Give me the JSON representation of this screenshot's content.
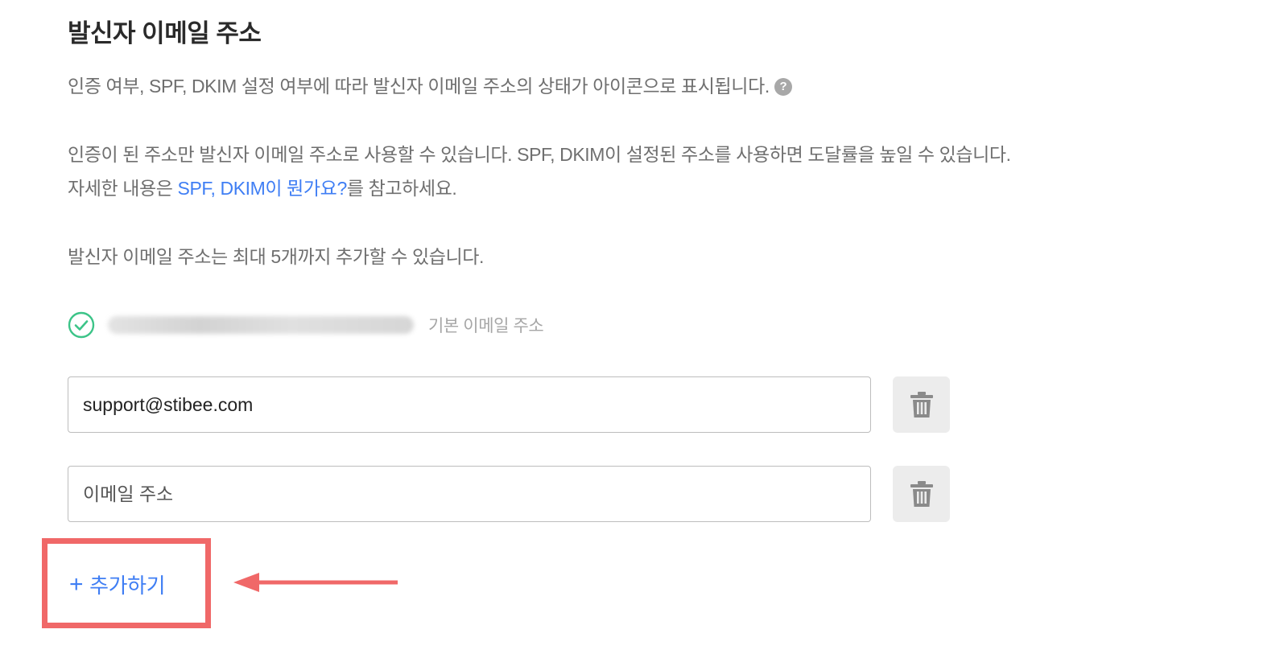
{
  "section": {
    "title": "발신자 이메일 주소"
  },
  "descriptions": {
    "line1": "인증 여부, SPF, DKIM 설정 여부에 따라 발신자 이메일 주소의 상태가 아이콘으로 표시됩니다.",
    "help_icon": "?",
    "line2": "인증이 된 주소만 발신자 이메일 주소로 사용할 수 있습니다. SPF, DKIM이 설정된 주소를 사용하면 도달률을 높일 수 있습니다.",
    "line3_prefix": "자세한 내용은 ",
    "line3_link": "SPF, DKIM이 뭔가요?",
    "line3_suffix": "를 참고하세요.",
    "line4": "발신자 이메일 주소는 최대 5개까지 추가할 수 있습니다."
  },
  "verified_email": {
    "status_icon": "check-circle-icon",
    "label": "기본 이메일 주소"
  },
  "email_inputs": [
    {
      "value": "support@stibee.com",
      "placeholder": "이메일 주소"
    },
    {
      "value": "",
      "placeholder": "이메일 주소"
    }
  ],
  "add_button": {
    "icon": "+",
    "label": "추가하기"
  },
  "colors": {
    "accent": "#3f7ef4",
    "success": "#3cc488",
    "annotation": "#f06868",
    "text_secondary": "#6f6f6f"
  }
}
